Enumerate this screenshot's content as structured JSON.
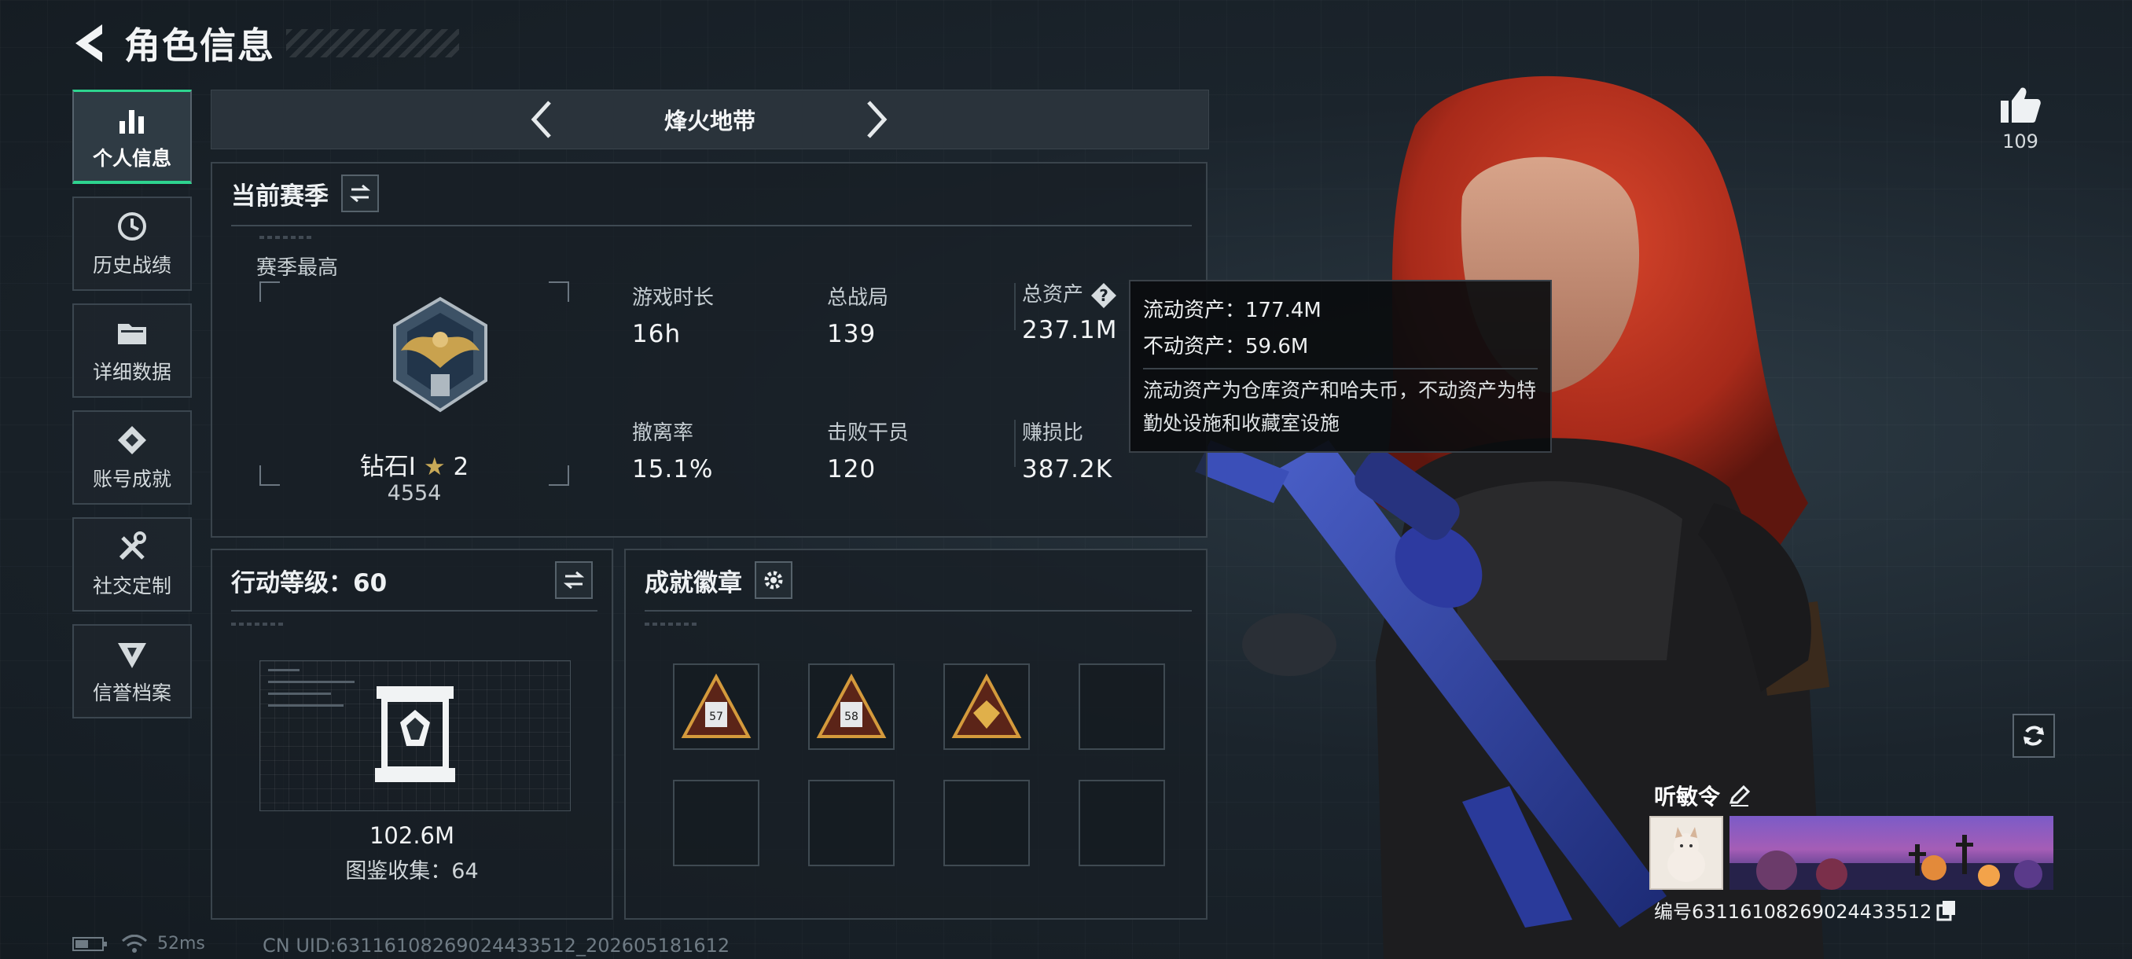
{
  "header": {
    "title": "角色信息"
  },
  "sidebar": {
    "items": [
      {
        "label": "个人信息",
        "icon": "bar-chart-icon",
        "active": true
      },
      {
        "label": "历史战绩",
        "icon": "history-clock-icon",
        "active": false
      },
      {
        "label": "详细数据",
        "icon": "folder-icon",
        "active": false
      },
      {
        "label": "账号成就",
        "icon": "achievement-diamond-icon",
        "active": false
      },
      {
        "label": "社交定制",
        "icon": "tools-icon",
        "active": false
      },
      {
        "label": "信誉档案",
        "icon": "shield-badge-icon",
        "active": false
      }
    ]
  },
  "mode": {
    "title": "烽火地带"
  },
  "season": {
    "title": "当前赛季",
    "best_label": "赛季最高",
    "rank_name": "钻石Ⅰ",
    "rank_stars": "2",
    "rank_score": "4554",
    "stats": [
      {
        "label": "游戏时长",
        "value": "16h"
      },
      {
        "label": "总战局",
        "value": "139"
      },
      {
        "label": "总资产",
        "value": "237.1M"
      },
      {
        "label": "撤离率",
        "value": "15.1%"
      },
      {
        "label": "击败干员",
        "value": "120"
      },
      {
        "label": "赚损比",
        "value": "387.2K"
      }
    ]
  },
  "tooltip": {
    "liquid": "流动资产：177.4M",
    "fixed": "不动资产：59.6M",
    "note": "流动资产为仓库资产和哈夫币，不动资产为特勤处设施和收藏室设施"
  },
  "action_level": {
    "title": "行动等级：60",
    "value": "102.6M",
    "collection": "图鉴收集：64"
  },
  "achievements": {
    "title": "成就徽章",
    "badges": [
      "57",
      "58",
      ""
    ]
  },
  "profile": {
    "likes": "109",
    "name": "听敏令",
    "id": "编号6311610826902443351​2"
  },
  "status": {
    "ping": "52ms",
    "uid": "CN UID:63116108269024433512_202605181612"
  },
  "colors": {
    "accent": "#2ed48f",
    "panel_border": "#3a444c"
  }
}
